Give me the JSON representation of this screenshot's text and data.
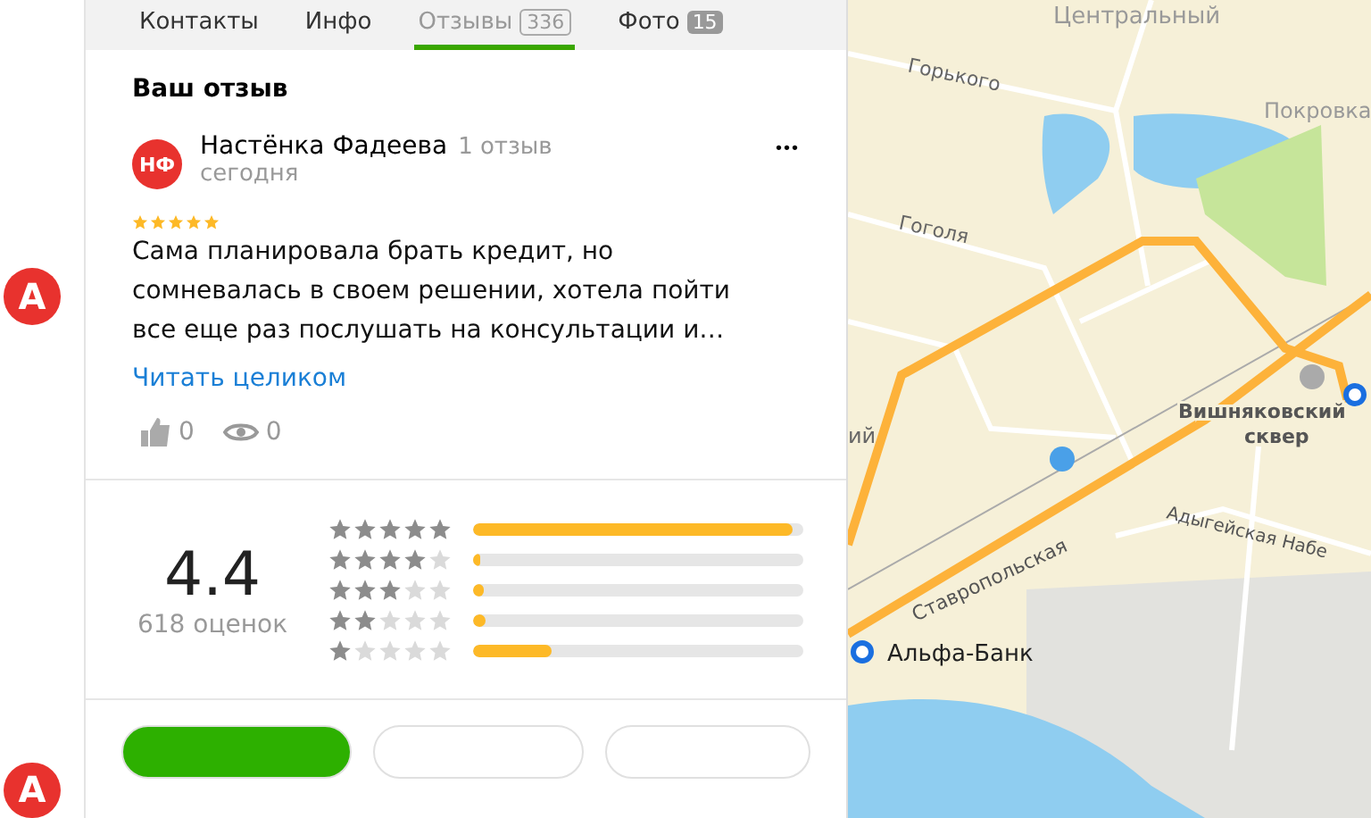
{
  "tabs": [
    {
      "label": "Контакты",
      "selected": false
    },
    {
      "label": "Инфо",
      "selected": false
    },
    {
      "label": "Отзывы",
      "count": "336",
      "selected": true
    },
    {
      "label": "Фото",
      "count": "15",
      "selected": false
    }
  ],
  "side_list": [
    {
      "letter": "А"
    },
    {
      "letter": "А"
    }
  ],
  "my_review": {
    "heading": "Ваш отзыв",
    "initials": "НФ",
    "author": "Настёнка Фадеева",
    "author_reviews": "1 отзыв",
    "date": "сегодня",
    "more": "•••",
    "stars": 5,
    "text": "Сама планировала брать кредит, но сомневалась в своем решении, хотела пойти все еще раз послушать на консультации и…",
    "read_more": "Читать целиком",
    "likes": "0",
    "views": "0"
  },
  "rating": {
    "score": "4.4",
    "count": "618 оценок",
    "bars": [
      {
        "stars": 5,
        "level": 0.97
      },
      {
        "stars": 4,
        "level": 0.02
      },
      {
        "stars": 3,
        "level": 0.03
      },
      {
        "stars": 2,
        "level": 0.04
      },
      {
        "stars": 1,
        "level": 0.24
      }
    ]
  },
  "filters": [
    {
      "selected": true
    },
    {
      "selected": false
    },
    {
      "selected": false
    }
  ],
  "map": {
    "labels": [
      "Центральный",
      "Горького",
      "Покровка",
      "Гоголя",
      "ий",
      "Вишняковский",
      "сквер",
      "Ставропольская",
      "Адыгейская Набе",
      "Альфа-Банк"
    ]
  }
}
